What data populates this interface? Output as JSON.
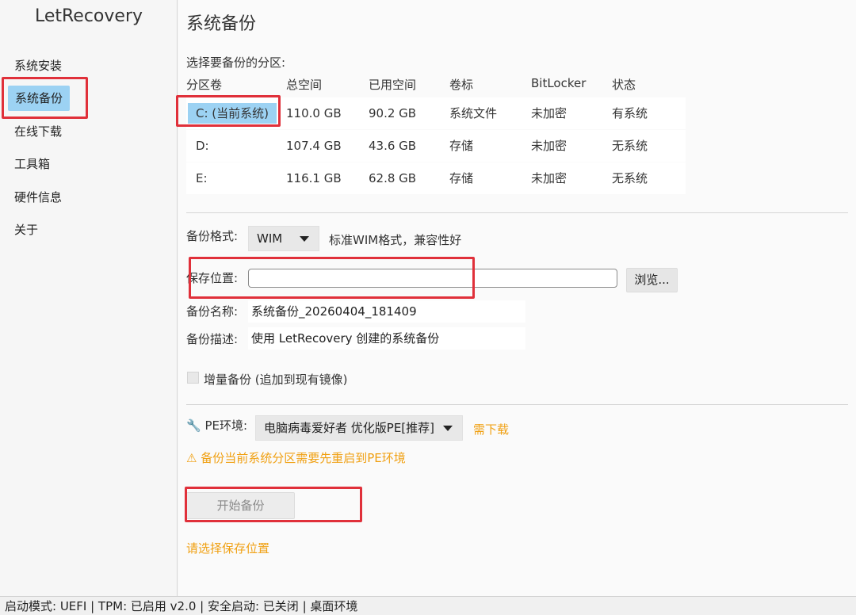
{
  "app": {
    "title": "LetRecovery"
  },
  "sidebar": {
    "items": [
      {
        "label": "系统安装"
      },
      {
        "label": "系统备份"
      },
      {
        "label": "在线下载"
      },
      {
        "label": "工具箱"
      },
      {
        "label": "硬件信息"
      },
      {
        "label": "关于"
      }
    ],
    "active": "系统备份"
  },
  "main": {
    "title": "系统备份",
    "partition_prompt": "选择要备份的分区:",
    "table": {
      "columns": [
        "分区卷",
        "总空间",
        "已用空间",
        "卷标",
        "BitLocker",
        "状态"
      ],
      "rows": [
        {
          "volume": "C: (当前系统)",
          "total": "110.0 GB",
          "used": "90.2 GB",
          "label": "系统文件",
          "bitlocker": "未加密",
          "status": "有系统",
          "selected": true
        },
        {
          "volume": "D:",
          "total": "107.4 GB",
          "used": "43.6 GB",
          "label": "存储",
          "bitlocker": "未加密",
          "status": "无系统",
          "selected": false
        },
        {
          "volume": "E:",
          "total": "116.1 GB",
          "used": "62.8 GB",
          "label": "存储",
          "bitlocker": "未加密",
          "status": "无系统",
          "selected": false
        }
      ]
    },
    "format": {
      "label": "备份格式:",
      "value": "WIM",
      "description": "标准WIM格式，兼容性好"
    },
    "save_location": {
      "label": "保存位置:",
      "value": "",
      "browse_label": "浏览..."
    },
    "backup_name": {
      "label": "备份名称:",
      "value": "系统备份_20260404_181409"
    },
    "backup_desc": {
      "label": "备份描述:",
      "value": "使用 LetRecovery 创建的系统备份"
    },
    "incremental": {
      "label": "增量备份 (追加到现有镜像)",
      "checked": false
    },
    "pe": {
      "icon": "wrench-icon",
      "label": "PE环境:",
      "value": "电脑病毒爱好者 优化版PE[推荐]",
      "download_label": "需下载",
      "warning": "⚠ 备份当前系统分区需要先重启到PE环境"
    },
    "start_button": {
      "label": "开始备份",
      "enabled": false
    },
    "hint": "请选择保存位置"
  },
  "statusbar": {
    "text": "启动模式: UEFI | TPM: 已启用 v2.0 | 安全启动: 已关闭 | 桌面环境"
  },
  "colors": {
    "selection": "#9cd2f3",
    "accent_warning": "#f0a012",
    "highlight_box": "#e0303a"
  }
}
